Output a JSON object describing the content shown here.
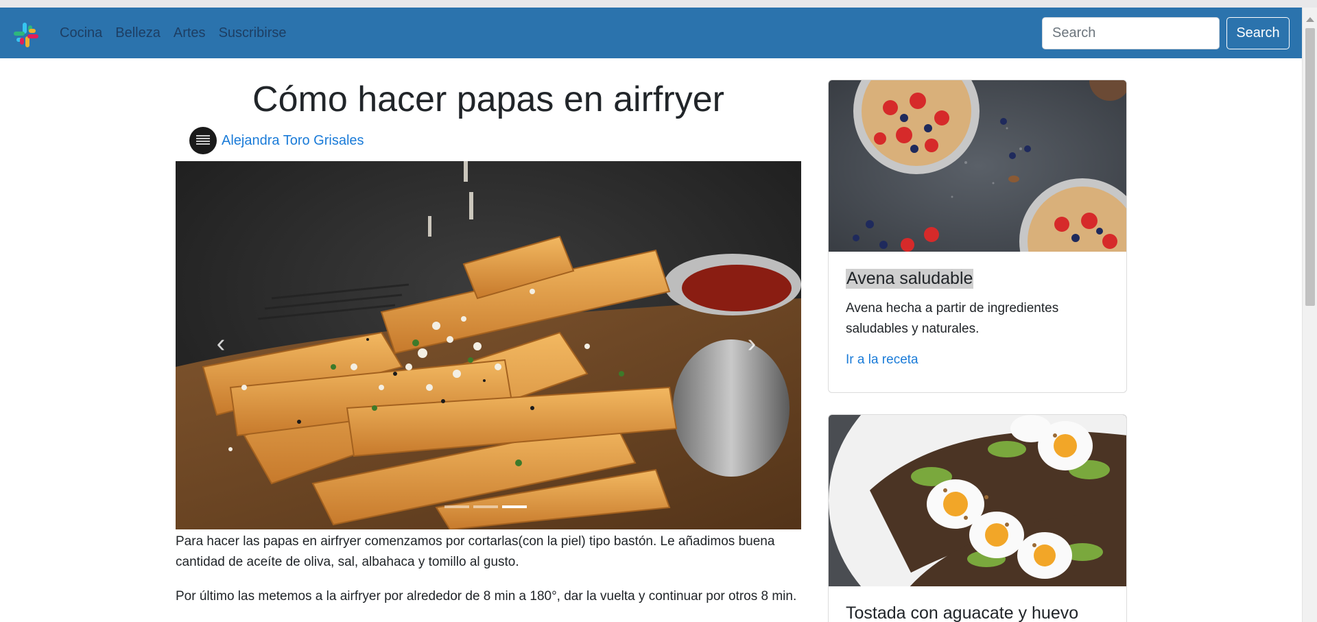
{
  "nav": {
    "logo_icon": "slack-style-logo-icon",
    "links": [
      "Cocina",
      "Belleza",
      "Artes",
      "Suscribirse"
    ],
    "search_placeholder": "Search",
    "search_button": "Search",
    "background": "#2b73ad"
  },
  "post": {
    "title": "Cómo hacer papas en airfryer",
    "author": "Alejandra Toro Grisales",
    "carousel": {
      "prev_icon": "chevron-left-icon",
      "next_icon": "chevron-right-icon",
      "slides": 3,
      "active_slide": 3
    },
    "paragraphs": [
      "Para hacer las papas en airfryer comenzamos por cortarlas(con la piel) tipo bastón. Le añadimos buena cantidad de aceíte de oliva, sal, albahaca y tomillo al gusto.",
      "Por último las metemos a la airfryer por alrededor de 8 min a 180°, dar la vuelta y continuar por otros 8 min."
    ]
  },
  "sidebar": {
    "cards": [
      {
        "title": "Avena saludable",
        "text": "Avena hecha a partir de ingredientes saludables y naturales.",
        "link": "Ir a la receta"
      },
      {
        "title": "Tostada con aguacate y huevo"
      }
    ]
  },
  "colors": {
    "link": "#1a7bd8",
    "text": "#212529"
  }
}
